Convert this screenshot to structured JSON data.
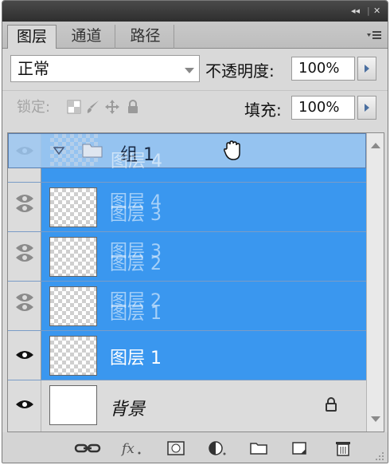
{
  "window": {
    "collapse_glyph": "◂◂",
    "close_glyph": "✕"
  },
  "tabs": [
    {
      "label": "图层"
    },
    {
      "label": "通道"
    },
    {
      "label": "路径"
    }
  ],
  "blend": {
    "value": "正常"
  },
  "opacity": {
    "label": "不透明度:",
    "value": "100%"
  },
  "lock": {
    "label": "锁定:",
    "icons": [
      "lock-transparent-icon",
      "lock-paint-icon",
      "lock-position-icon",
      "lock-all-icon"
    ]
  },
  "fill": {
    "label": "填充:",
    "value": "100%"
  },
  "group": {
    "name": "组 1",
    "ghost_label": "图层 4"
  },
  "layers": [
    {
      "name": "图层 4",
      "ghost": "图层 3"
    },
    {
      "name": "图层 3",
      "ghost": "图层 2"
    },
    {
      "name": "图层 2",
      "ghost": "图层 1"
    },
    {
      "name": "图层 1"
    },
    {
      "name": "背景"
    }
  ],
  "bottom_icons": [
    "link-icon",
    "fx-icon",
    "mask-icon",
    "adjustment-icon",
    "folder-icon",
    "new-layer-icon",
    "trash-icon"
  ],
  "colors": {
    "selection": "#3a97ef",
    "group_drop": "#a0c8f0",
    "panel_bg": "#d9d9d9"
  }
}
